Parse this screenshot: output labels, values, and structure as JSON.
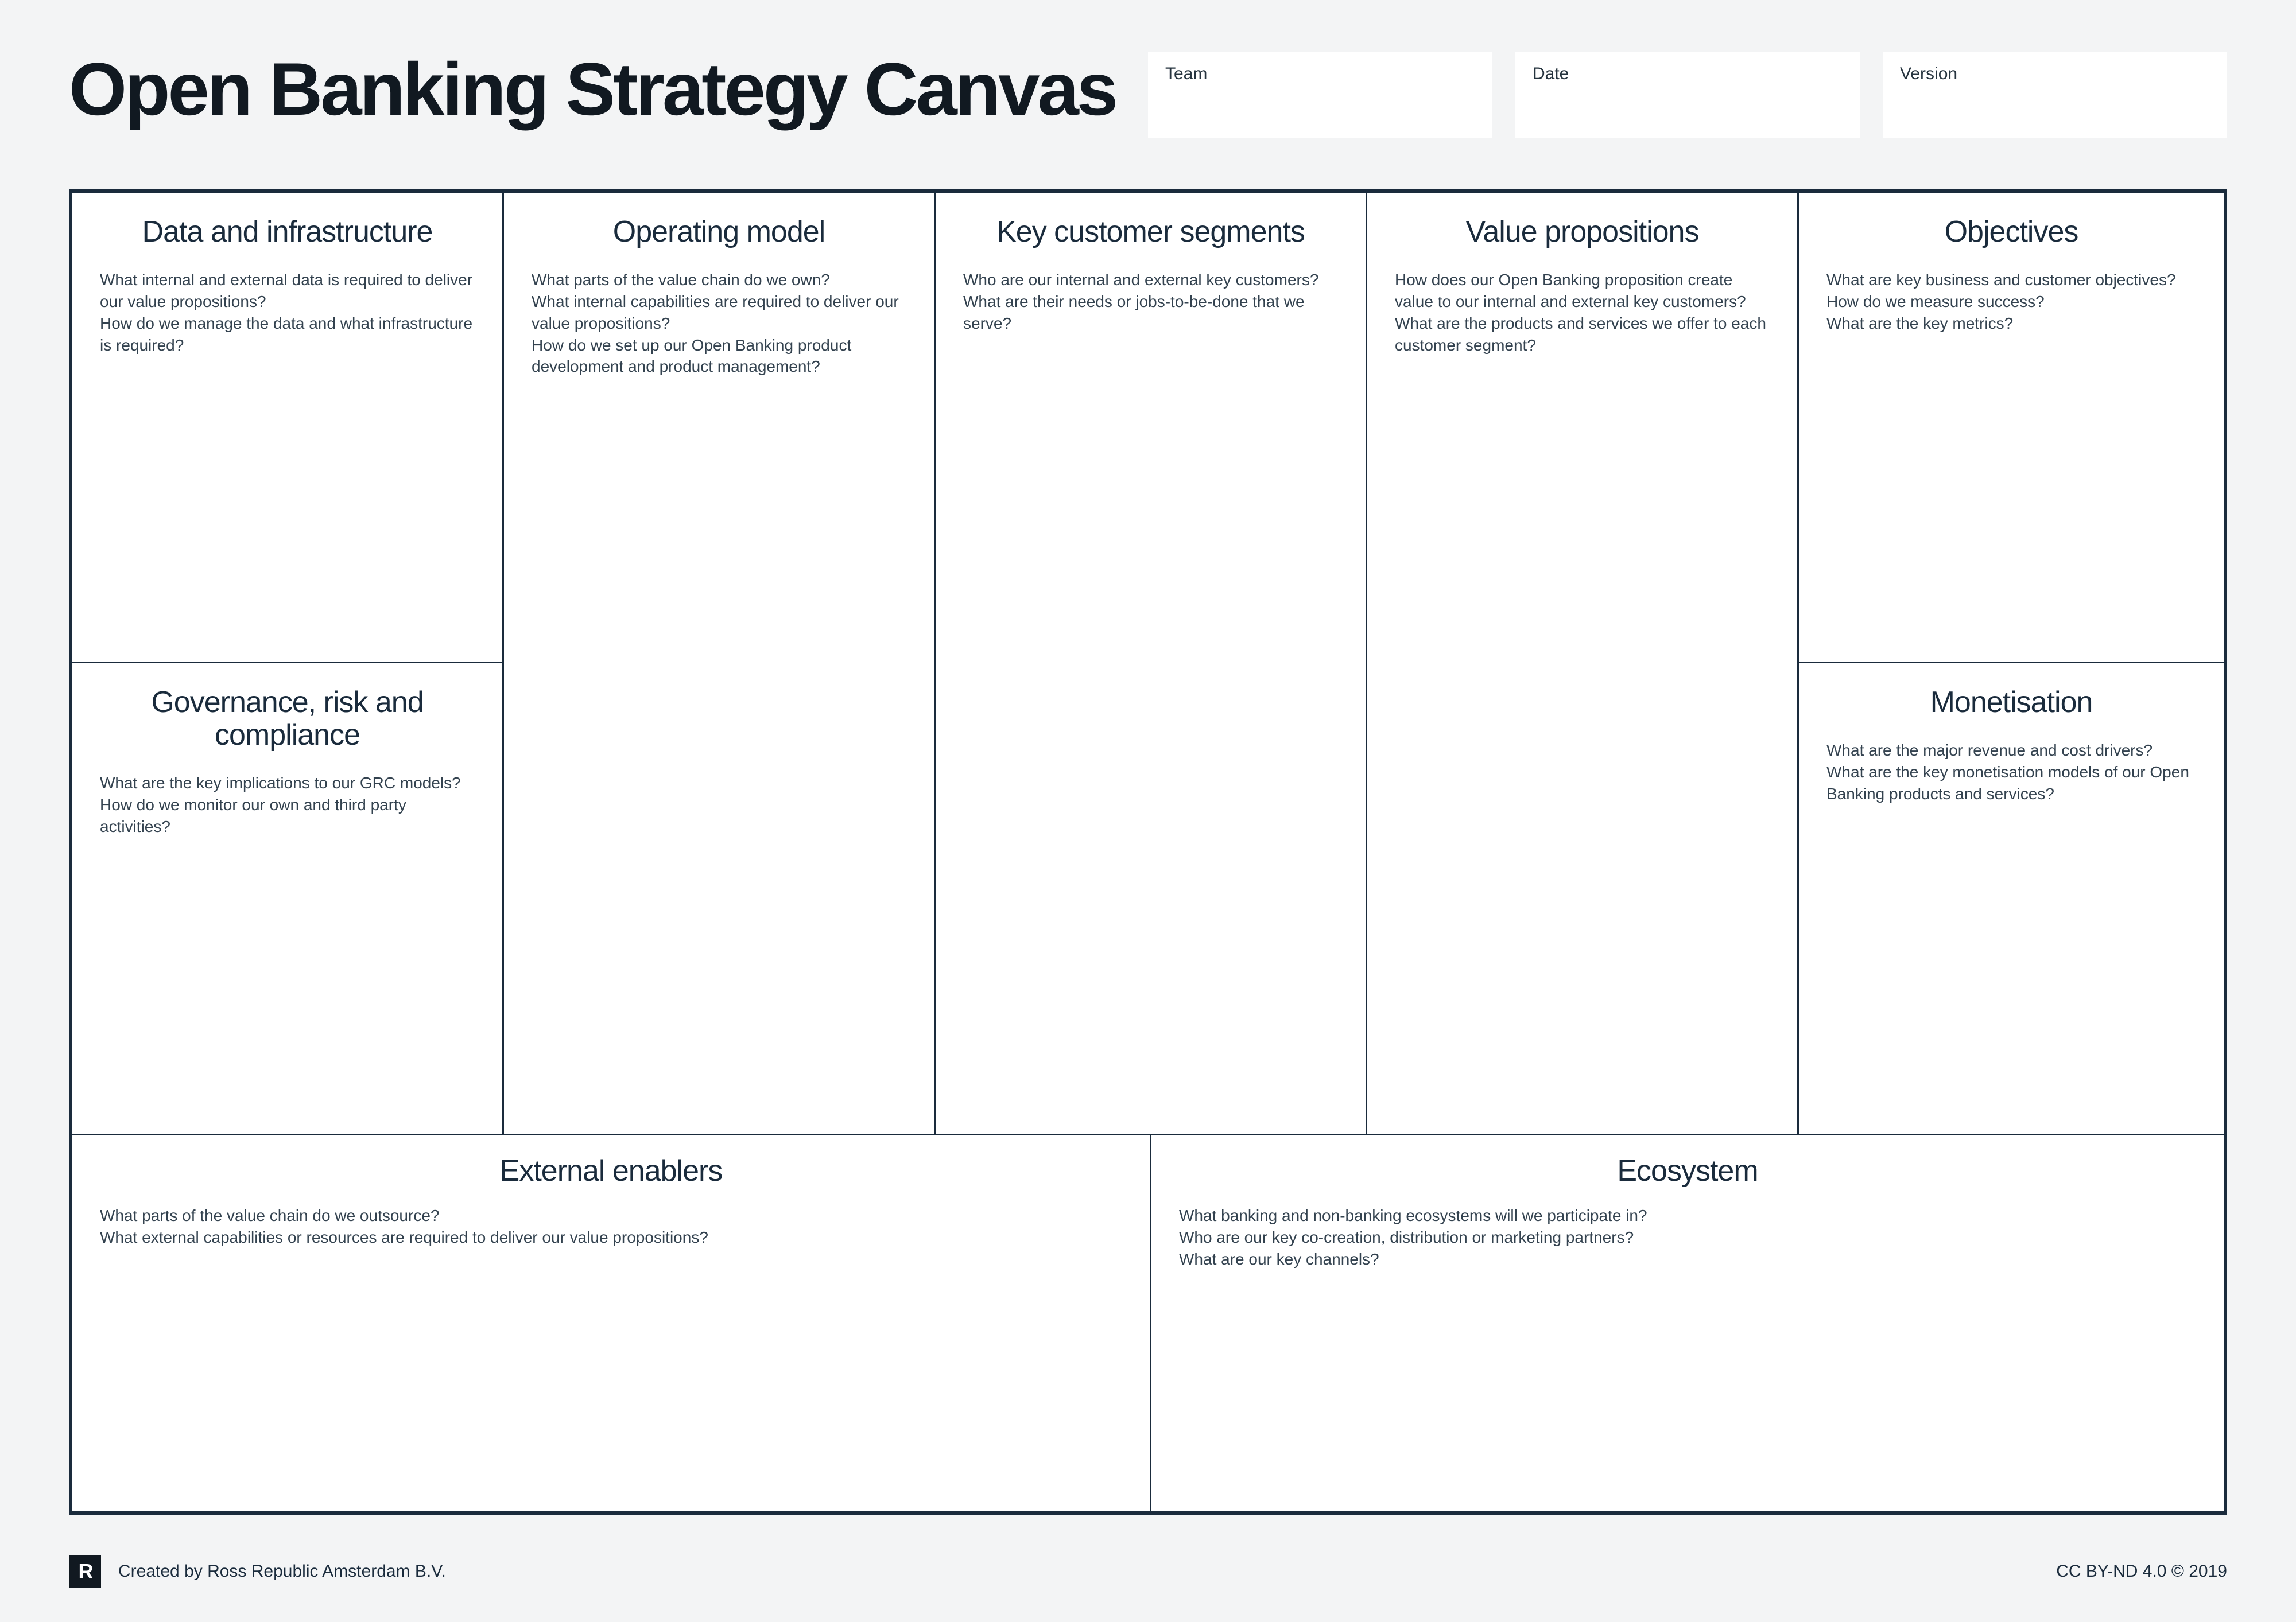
{
  "title": "Open Banking Strategy Canvas",
  "meta": {
    "team_label": "Team",
    "date_label": "Date",
    "version_label": "Version"
  },
  "cells": {
    "data_infra": {
      "title": "Data and infrastructure",
      "text": "What internal and external data is required to deliver our value propositions?\nHow do we manage the data and what infrastructure is required?"
    },
    "operating_model": {
      "title": "Operating model",
      "text": "What parts of the value chain do we own?\nWhat internal capabilities are required to deliver our value propositions?\nHow do we set up our Open Banking product development and product management?"
    },
    "key_segments": {
      "title": "Key customer segments",
      "text": "Who are our internal and external key customers?\nWhat are their needs or jobs-to-be-done that we serve?"
    },
    "value_props": {
      "title": "Value propositions",
      "text": "How does our Open Banking proposition create value to our internal and external key customers?\nWhat are the products and services we offer to each customer segment?"
    },
    "objectives": {
      "title": "Objectives",
      "text": "What are key business and customer objectives?\nHow do we measure success?\nWhat are the key metrics?"
    },
    "grc": {
      "title": "Governance, risk and compliance",
      "text": "What are the key implications to our GRC models?\nHow do we monitor our own and third party activities?"
    },
    "monetisation": {
      "title": "Monetisation",
      "text": "What are the major revenue and cost drivers?\nWhat are the key monetisation models of our Open Banking products and services?"
    },
    "external_enablers": {
      "title": "External enablers",
      "text": "What parts of the value chain do we outsource?\nWhat external capabilities or resources are required to deliver our value propositions?"
    },
    "ecosystem": {
      "title": "Ecosystem",
      "text": "What banking and non-banking ecosystems will we participate in?\nWho are our key co-creation, distribution or marketing partners?\nWhat are our key channels?"
    }
  },
  "footer": {
    "logo_text": "R",
    "created_by": "Created by Ross Republic Amsterdam B.V.",
    "license": "CC BY-ND 4.0 © 2019"
  }
}
